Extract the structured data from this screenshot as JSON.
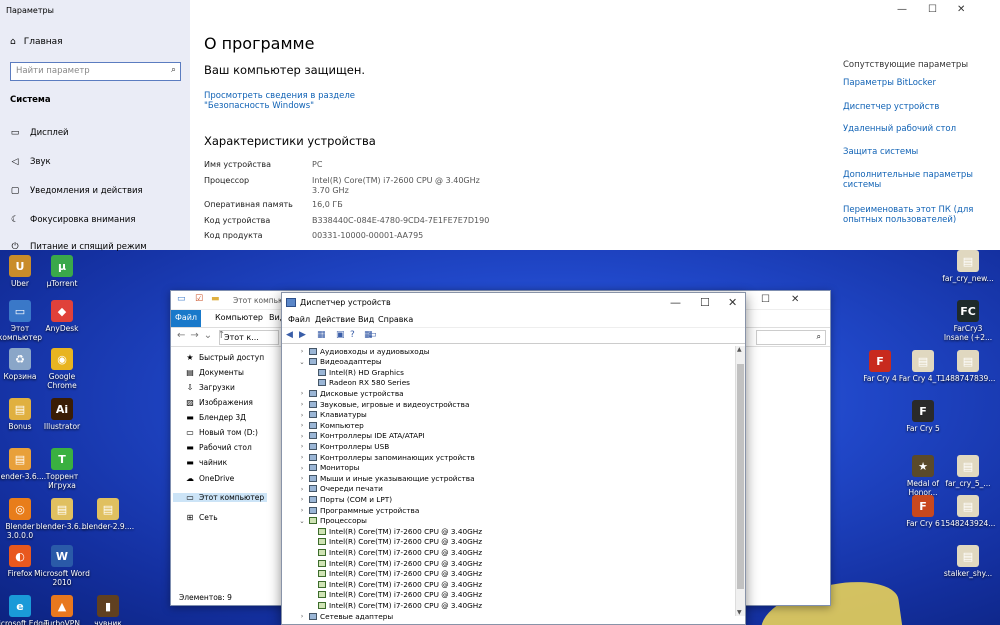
{
  "settings": {
    "window_title": "Параметры",
    "home": "Главная",
    "search_placeholder": "Найти параметр",
    "section": "Система",
    "sidebar_items": [
      "Дисплей",
      "Звук",
      "Уведомления и действия",
      "Фокусировка внимания",
      "Питание и спящий режим"
    ],
    "page_title": "О программе",
    "protected": "Ваш компьютер защищен.",
    "security_link": "Просмотреть сведения в разделе \"Безопасность Windows\"",
    "specs_title": "Характеристики устройства",
    "specs": [
      {
        "k": "Имя устройства",
        "v": "PC"
      },
      {
        "k": "Процессор",
        "v": "Intel(R) Core(TM) i7-2600 CPU @ 3.40GHz 3.70 GHz"
      },
      {
        "k": "Оперативная память",
        "v": "16,0 ГБ"
      },
      {
        "k": "Код устройства",
        "v": "B338440C-084E-4780-9CD4-7E1FE7E7D190"
      },
      {
        "k": "Код продукта",
        "v": "00331-10000-00001-AA795"
      }
    ],
    "related_title": "Сопутствующие параметры",
    "related_links": [
      "Параметры BitLocker",
      "Диспетчер устройств",
      "Удаленный рабочий стол",
      "Защита системы",
      "Дополнительные параметры системы",
      "Переименовать этот ПК (для опытных пользователей)"
    ]
  },
  "desktop": {
    "icons": [
      {
        "label": "Uber",
        "color": "#c98c2a",
        "glyph": "U"
      },
      {
        "label": "µTorrent",
        "color": "#3aa84a",
        "glyph": "µ"
      },
      {
        "label": "Этот компьютер",
        "color": "#3a78c8",
        "glyph": "▭"
      },
      {
        "label": "AnyDesk",
        "color": "#e0413a",
        "glyph": "◆"
      },
      {
        "label": "Корзина",
        "color": "#8aa6c8",
        "glyph": "♻"
      },
      {
        "label": "Google Chrome",
        "color": "#e8b421",
        "glyph": "◉"
      },
      {
        "label": "Bonus",
        "color": "#e0b040",
        "glyph": "▤"
      },
      {
        "label": "Illustrator",
        "color": "#3a1d05",
        "glyph": "Ai"
      },
      {
        "label": "blender-3.6....",
        "color": "#e8a03a",
        "glyph": "▤"
      },
      {
        "label": "Торрент Игруха",
        "color": "#3ab040",
        "glyph": "T"
      },
      {
        "label": "Blender 3.0.0.0",
        "color": "#e87d1a",
        "glyph": "◎"
      },
      {
        "label": "blender-3.6....",
        "color": "#e0c060",
        "glyph": "▤"
      },
      {
        "label": "blender-2.9....",
        "color": "#e0c060",
        "glyph": "▤"
      },
      {
        "label": "Firefox",
        "color": "#e8581e",
        "glyph": "◐"
      },
      {
        "label": "Microsoft Word 2010",
        "color": "#2a5aa8",
        "glyph": "W"
      },
      {
        "label": "Microsoft Edge",
        "color": "#1a9ad8",
        "glyph": "e"
      },
      {
        "label": "TurboVPN",
        "color": "#e8781e",
        "glyph": "▲"
      },
      {
        "label": "чувник",
        "color": "#604020",
        "glyph": "▮"
      },
      {
        "label": "far_cry_new...",
        "color": "#e0d8c0",
        "glyph": "▤"
      },
      {
        "label": "FarCry3 Insane (+2...",
        "color": "#1e2a2a",
        "glyph": "FC"
      },
      {
        "label": "Far Cry 4",
        "color": "#c82a1e",
        "glyph": "F"
      },
      {
        "label": "Far Cry 4_T...",
        "color": "#e0d8c0",
        "glyph": "▤"
      },
      {
        "label": "1488747839...",
        "color": "#e0d8c0",
        "glyph": "▤"
      },
      {
        "label": "Far Cry 5",
        "color": "#2a2a2a",
        "glyph": "F"
      },
      {
        "label": "Medal of Honor...",
        "color": "#5a4a2a",
        "glyph": "★"
      },
      {
        "label": "far_cry_5_...",
        "color": "#e0d8c0",
        "glyph": "▤"
      },
      {
        "label": "Far Cry 6",
        "color": "#c8481e",
        "glyph": "F"
      },
      {
        "label": "1548243924...",
        "color": "#e0d8c0",
        "glyph": "▤"
      },
      {
        "label": "stalker_shy...",
        "color": "#e0d8c0",
        "glyph": "▤"
      }
    ]
  },
  "explorer": {
    "title": "Этот компьютер",
    "tabs": [
      "Файл",
      "Компьютер",
      "Вид"
    ],
    "address": "Этот к...",
    "tree": [
      {
        "label": "Быстрый доступ",
        "icon": "★"
      },
      {
        "label": "Документы",
        "icon": "▤"
      },
      {
        "label": "Загрузки",
        "icon": "⇩"
      },
      {
        "label": "Изображения",
        "icon": "▨"
      },
      {
        "label": "Блендер 3Д",
        "icon": "▬"
      },
      {
        "label": "Новый том (D:)",
        "icon": "▭"
      },
      {
        "label": "Рабочий стол",
        "icon": "▬"
      },
      {
        "label": "чайник",
        "icon": "▬"
      },
      {
        "label": "OneDrive",
        "icon": "☁"
      },
      {
        "label": "Этот компьютер",
        "icon": "▭"
      },
      {
        "label": "Сеть",
        "icon": "⊞"
      }
    ],
    "status": "Элементов: 9"
  },
  "devmgr": {
    "title": "Диспетчер устройств",
    "menu": [
      "Файл",
      "Действие",
      "Вид",
      "Справка"
    ],
    "rows": [
      {
        "label": "Аудиовходы и аудиовыходы",
        "level": 0,
        "exp": "›",
        "cpu": false
      },
      {
        "label": "Видеоадаптеры",
        "level": 0,
        "exp": "⌄",
        "cpu": false
      },
      {
        "label": "Intel(R) HD Graphics",
        "level": 1,
        "exp": "",
        "cpu": false
      },
      {
        "label": "Radeon RX 580 Series",
        "level": 1,
        "exp": "",
        "cpu": false
      },
      {
        "label": "Дисковые устройства",
        "level": 0,
        "exp": "›",
        "cpu": false
      },
      {
        "label": "Звуковые, игровые и видеоустройства",
        "level": 0,
        "exp": "›",
        "cpu": false
      },
      {
        "label": "Клавиатуры",
        "level": 0,
        "exp": "›",
        "cpu": false
      },
      {
        "label": "Компьютер",
        "level": 0,
        "exp": "›",
        "cpu": false
      },
      {
        "label": "Контроллеры IDE ATA/ATAPI",
        "level": 0,
        "exp": "›",
        "cpu": false
      },
      {
        "label": "Контроллеры USB",
        "level": 0,
        "exp": "›",
        "cpu": false
      },
      {
        "label": "Контроллеры запоминающих устройств",
        "level": 0,
        "exp": "›",
        "cpu": false
      },
      {
        "label": "Мониторы",
        "level": 0,
        "exp": "›",
        "cpu": false
      },
      {
        "label": "Мыши и иные указывающие устройства",
        "level": 0,
        "exp": "›",
        "cpu": false
      },
      {
        "label": "Очереди печати",
        "level": 0,
        "exp": "›",
        "cpu": false
      },
      {
        "label": "Порты (COM и LPT)",
        "level": 0,
        "exp": "›",
        "cpu": false
      },
      {
        "label": "Программные устройства",
        "level": 0,
        "exp": "›",
        "cpu": false
      },
      {
        "label": "Процессоры",
        "level": 0,
        "exp": "⌄",
        "cpu": true
      },
      {
        "label": "Intel(R) Core(TM) i7-2600 CPU @ 3.40GHz",
        "level": 1,
        "exp": "",
        "cpu": true
      },
      {
        "label": "Intel(R) Core(TM) i7-2600 CPU @ 3.40GHz",
        "level": 1,
        "exp": "",
        "cpu": true
      },
      {
        "label": "Intel(R) Core(TM) i7-2600 CPU @ 3.40GHz",
        "level": 1,
        "exp": "",
        "cpu": true
      },
      {
        "label": "Intel(R) Core(TM) i7-2600 CPU @ 3.40GHz",
        "level": 1,
        "exp": "",
        "cpu": true
      },
      {
        "label": "Intel(R) Core(TM) i7-2600 CPU @ 3.40GHz",
        "level": 1,
        "exp": "",
        "cpu": true
      },
      {
        "label": "Intel(R) Core(TM) i7-2600 CPU @ 3.40GHz",
        "level": 1,
        "exp": "",
        "cpu": true
      },
      {
        "label": "Intel(R) Core(TM) i7-2600 CPU @ 3.40GHz",
        "level": 1,
        "exp": "",
        "cpu": true
      },
      {
        "label": "Intel(R) Core(TM) i7-2600 CPU @ 3.40GHz",
        "level": 1,
        "exp": "",
        "cpu": true
      },
      {
        "label": "Сетевые адаптеры",
        "level": 0,
        "exp": "›",
        "cpu": false
      }
    ]
  }
}
